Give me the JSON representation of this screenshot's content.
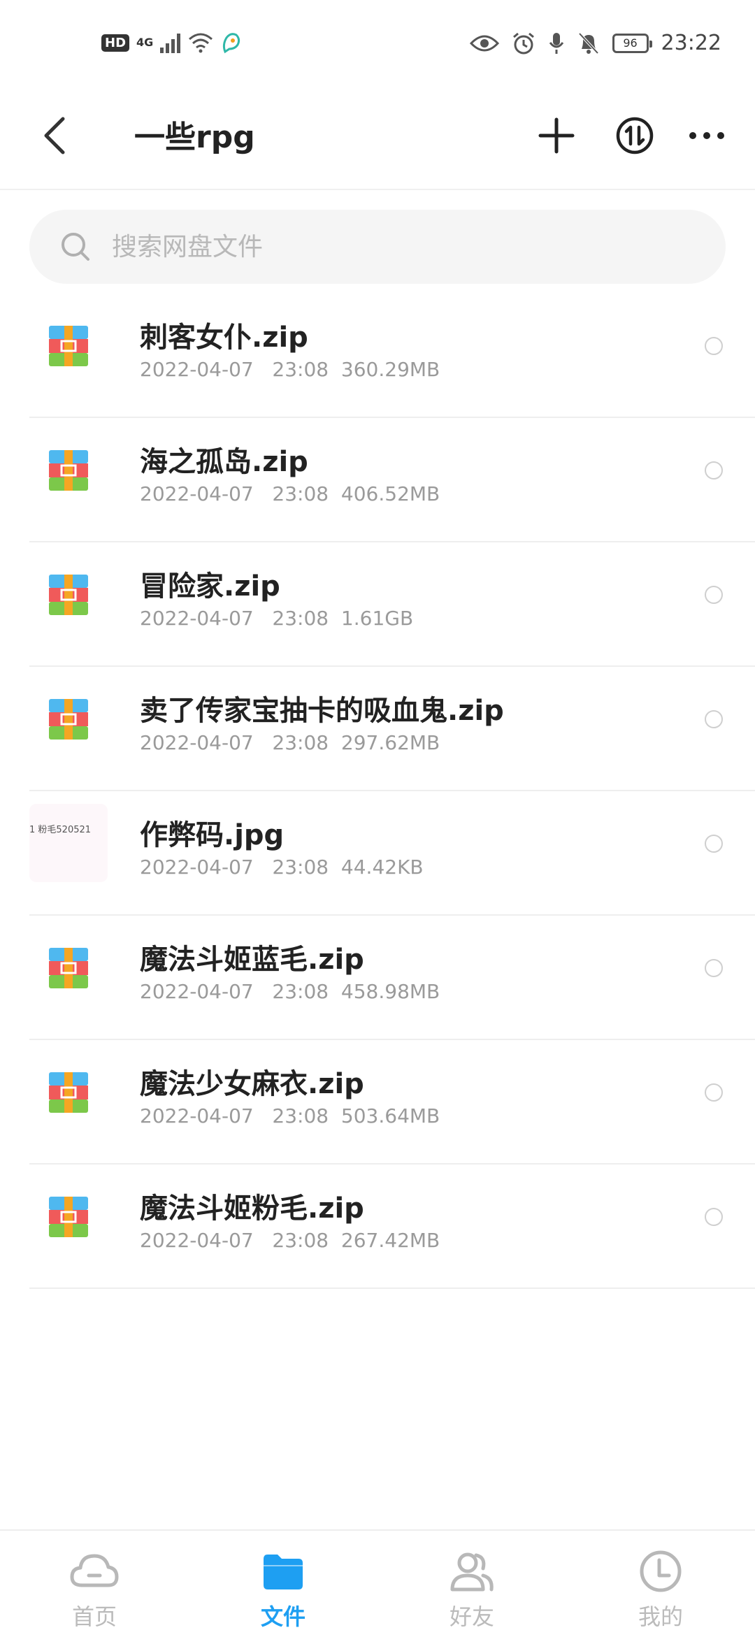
{
  "status_bar": {
    "hd": "HD",
    "network": "4G",
    "battery": "96",
    "time": "23:22"
  },
  "header": {
    "title": "一些rpg"
  },
  "search": {
    "placeholder": "搜索网盘文件"
  },
  "files": [
    {
      "name": "刺客女仆.zip",
      "meta": "2022-04-07   23:08  360.29MB",
      "type": "zip"
    },
    {
      "name": "海之孤岛.zip",
      "meta": "2022-04-07   23:08  406.52MB",
      "type": "zip"
    },
    {
      "name": "冒险家.zip",
      "meta": "2022-04-07   23:08  1.61GB",
      "type": "zip"
    },
    {
      "name": "卖了传家宝抽卡的吸血鬼.zip",
      "meta": "2022-04-07   23:08  297.62MB",
      "type": "zip"
    },
    {
      "name": "作弊码.jpg",
      "meta": "2022-04-07   23:08  44.42KB",
      "type": "image",
      "thumb_text": "1 粉毛520521"
    },
    {
      "name": "魔法斗姬蓝毛.zip",
      "meta": "2022-04-07   23:08  458.98MB",
      "type": "zip"
    },
    {
      "name": "魔法少女麻衣.zip",
      "meta": "2022-04-07   23:08  503.64MB",
      "type": "zip"
    },
    {
      "name": "魔法斗姬粉毛.zip",
      "meta": "2022-04-07   23:08  267.42MB",
      "type": "zip"
    }
  ],
  "bottom_nav": [
    {
      "label": "首页",
      "icon": "cloud-icon"
    },
    {
      "label": "文件",
      "icon": "folder-icon",
      "active": true
    },
    {
      "label": "好友",
      "icon": "friends-icon"
    },
    {
      "label": "我的",
      "icon": "profile-icon"
    }
  ],
  "colors": {
    "accent": "#1e9ff2",
    "zip_top": "#4fb8ef",
    "zip_mid": "#f05a5a",
    "zip_bottom": "#7cc84a",
    "zip_strap": "#f5a623"
  }
}
